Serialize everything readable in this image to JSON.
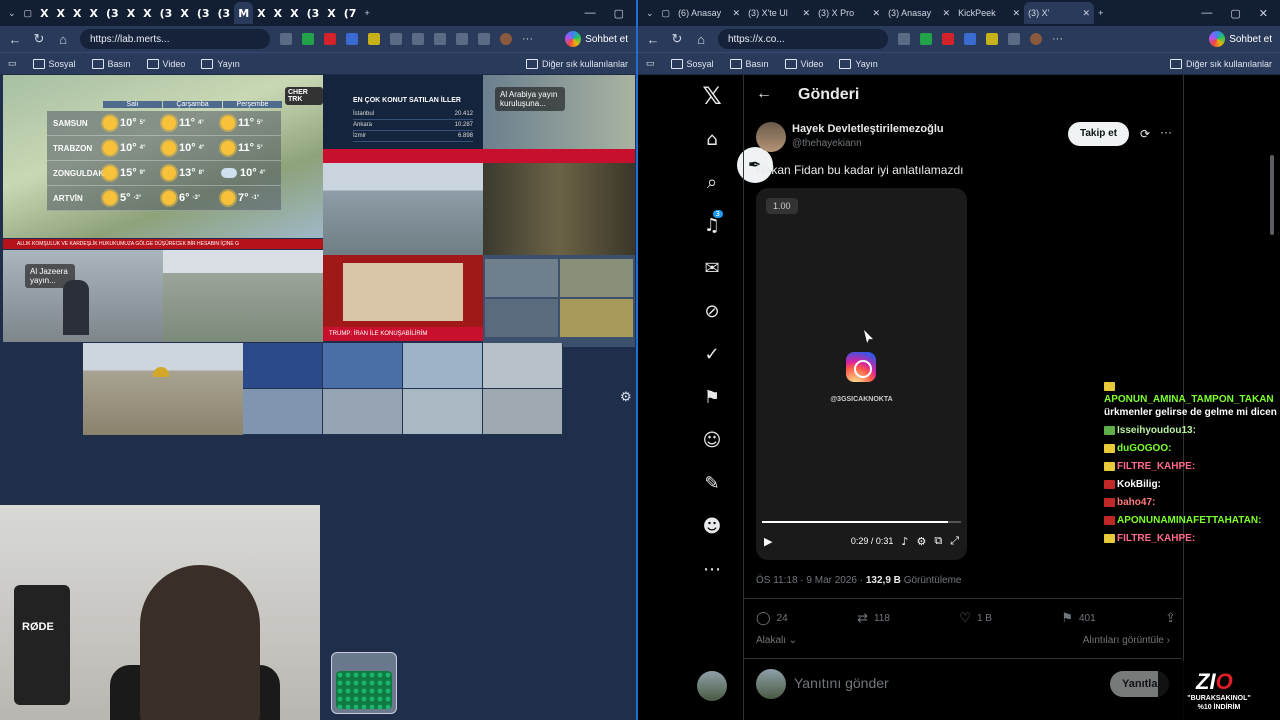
{
  "left_window": {
    "tabs": [
      "X",
      "X",
      "X",
      "X",
      "(3",
      "X",
      "X",
      "(3",
      "X",
      "(3",
      "(3",
      "M",
      "X",
      "X",
      "X",
      "(3",
      "X",
      "(7"
    ],
    "active_tab": "M",
    "url": "https://lab.merts...",
    "chat_button": "Sohbet et",
    "bookmarks": [
      "Sosyal",
      "Basın",
      "Video",
      "Yayın"
    ],
    "other_bookmarks": "Diğer sık kullanılanlar",
    "weather": {
      "days": [
        "Salı",
        "Çarşamba",
        "Perşembe"
      ],
      "rows": [
        {
          "city": "SAMSUN",
          "t": [
            "10°",
            "11°",
            "11°"
          ],
          "l": [
            "5°",
            "4°",
            "5°"
          ],
          "icons": [
            "sun-icon",
            "sun-icon",
            "sun-icon"
          ]
        },
        {
          "city": "TRABZON",
          "t": [
            "10°",
            "10°",
            "11°"
          ],
          "l": [
            "4°",
            "4°",
            "5°"
          ],
          "icons": [
            "sun-icon",
            "sun-icon",
            "sun-icon"
          ]
        },
        {
          "city": "ZONGULDAK",
          "t": [
            "15°",
            "13°",
            "10°"
          ],
          "l": [
            "9°",
            "8°",
            "4°"
          ],
          "icons": [
            "sun-icon",
            "sun-icon",
            "cloud-icon"
          ]
        },
        {
          "city": "ARTVİN",
          "t": [
            "5°",
            "6°",
            "7°"
          ],
          "l": [
            "-3°",
            "-3°",
            "-1°"
          ],
          "icons": [
            "sun-icon",
            "sun-icon",
            "sun-icon"
          ]
        }
      ]
    },
    "news_a": {
      "title": "EN ÇOK KONUT SATILAN İLLER",
      "rows": [
        [
          "İstanbul",
          "20.412"
        ],
        [
          "Ankara",
          "10.287"
        ],
        [
          "İzmir",
          "6.898"
        ]
      ]
    },
    "alarabiya_label": "Al Arabiya yayın kuruluşuna...",
    "aljazeera_label": "Al Jazeera yayın...",
    "banner_text": "ALLIK KOMŞULUK VE KARDEŞLİK HUKUKUMUZA GÖLGE DÜŞÜRECEK BİR HESABIN İÇİNE G",
    "trump_text": "TRUMP: İRAN İLE KONUŞABİLİRİM",
    "mic_brand": "RØDE"
  },
  "right_window": {
    "tabs": [
      "(6) Anasay",
      "(3) X'te Ul",
      "(3) X Pro",
      "(3) Anasay",
      "KickPeek",
      "(3) X'"
    ],
    "url": "https://x.co...",
    "chat_button": "Sohbet et",
    "bookmarks": [
      "Sosyal",
      "Basın",
      "Video",
      "Yayın"
    ],
    "other_bookmarks": "Diğer sık kullanılanlar",
    "header_title": "Gönderi",
    "notif_count": "3",
    "post": {
      "author": "Hayek Devletleştirilemezoğlu",
      "handle": "@thehayekiann",
      "follow_label": "Takip et",
      "text": "Hakan Fidan bu kadar iyi anlatılamazdı",
      "video_speed": "1.00",
      "video_watermark": "@3GSICAKNOKTA",
      "video_time": "0:29 / 0:31",
      "video_progress": 0.935,
      "timestamp": "ÖS 11:18 · 9 Mar 2026 ·",
      "views_value": "132,9 B",
      "views_label": "Görüntüleme",
      "replies": "24",
      "reposts": "118",
      "likes": "1 B",
      "bookmarks": "401",
      "sort_label": "Alakalı",
      "quotes_label": "Alıntıları görüntüle",
      "reply_placeholder": "Yanıtını gönder",
      "reply_button": "Yanıtla"
    },
    "chat": [
      {
        "user": "APONUN_AMINA_TAMPON_TAKAN",
        "msg": "ürkmenler gelirse de gelme mi dicen",
        "color": "#7cff2d"
      },
      {
        "user": "Isseihyoudou13:",
        "msg": "",
        "color": "#b9f0a0"
      },
      {
        "user": "duGOGOO:",
        "msg": "",
        "color": "#7cff2d"
      },
      {
        "user": "FILTRE_KAHPE:",
        "msg": "",
        "color": "#ff6a8a"
      },
      {
        "user": "KokBilig:",
        "msg": "",
        "color": "#ffffff"
      },
      {
        "user": "baho47:",
        "msg": "",
        "color": "#ff7a7a"
      },
      {
        "user": "APONUNAMINAFETTAHATAN:",
        "msg": "",
        "color": "#7cff2d"
      },
      {
        "user": "FILTRE_KAHPE:",
        "msg": "",
        "color": "#ff6a8a"
      }
    ],
    "sponsor": {
      "logo_a": "ZI",
      "logo_b": "O",
      "line1": "\"BURAKSAKINOL\"",
      "line2": "%10 İNDİRİM"
    }
  }
}
